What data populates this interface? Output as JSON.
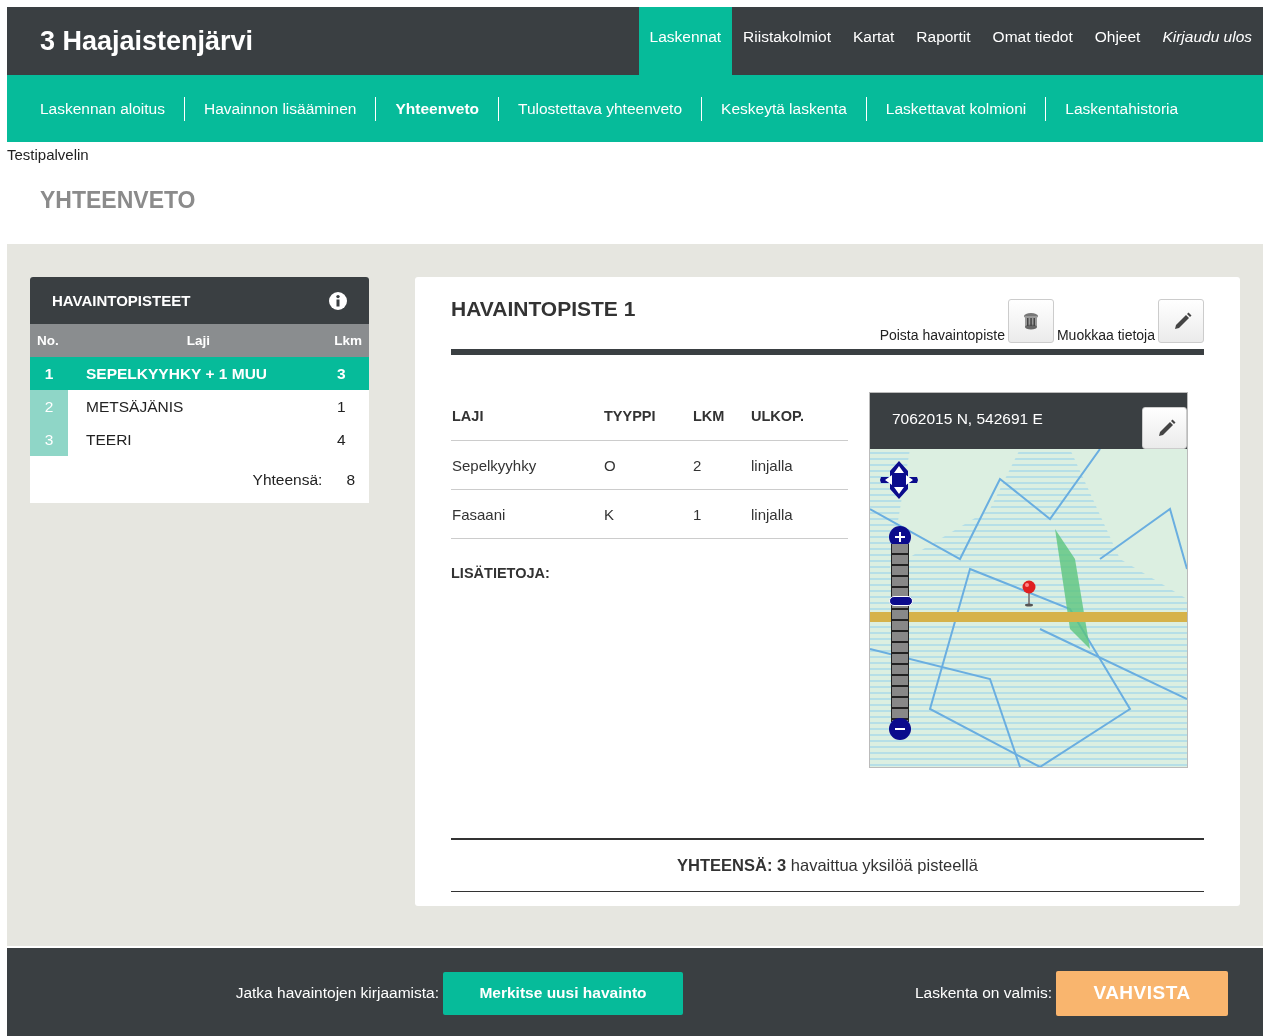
{
  "header": {
    "title": "3 Haajaistenjärvi",
    "menu": [
      {
        "label": "Laskennat",
        "selected": true,
        "kind": "link"
      },
      {
        "label": "Riistakolmiot",
        "selected": false,
        "kind": "link"
      },
      {
        "label": "Kartat",
        "selected": false,
        "kind": "link"
      },
      {
        "label": "Raportit",
        "selected": false,
        "kind": "link"
      },
      {
        "label": "Omat tiedot",
        "selected": false,
        "kind": "link"
      },
      {
        "label": "Ohjeet",
        "selected": false,
        "kind": "link"
      },
      {
        "label": "Kirjaudu ulos",
        "selected": false,
        "kind": "logout"
      }
    ]
  },
  "subnav": [
    {
      "label": "Laskennan aloitus",
      "selected": false
    },
    {
      "label": "Havainnon lisääminen",
      "selected": false
    },
    {
      "label": "Yhteenveto",
      "selected": true
    },
    {
      "label": "Tulostettava yhteenveto",
      "selected": false
    },
    {
      "label": "Keskeytä laskenta",
      "selected": false
    },
    {
      "label": "Laskettavat kolmioni",
      "selected": false
    },
    {
      "label": "Laskentahistoria",
      "selected": false
    }
  ],
  "environment": "Testipalvelin",
  "page_title": "YHTEENVETO",
  "points_panel": {
    "title": "HAVAINTOPISTEET",
    "columns": [
      "No.",
      "Laji",
      "Lkm"
    ],
    "rows": [
      {
        "no": "1",
        "species": "SEPELKYYHKY + 1 MUU",
        "count": "3",
        "selected": true
      },
      {
        "no": "2",
        "species": "METSÄJÄNIS",
        "count": "1",
        "selected": false
      },
      {
        "no": "3",
        "species": "TEERI",
        "count": "4",
        "selected": false
      }
    ],
    "total_label": "Yhteensä:",
    "total": "8"
  },
  "point": {
    "title": "HAVAINTOPISTE 1",
    "delete_label": "Poista havaintopiste",
    "edit_label": "Muokkaa tietoja",
    "columns": [
      "LAJI",
      "TYYPPI",
      "LKM",
      "ULKOP."
    ],
    "rows": [
      [
        "Sepelkyyhky",
        "O",
        "2",
        "linjalla"
      ],
      [
        "Fasaani",
        "K",
        "1",
        "linjalla"
      ]
    ],
    "notes_label": "LISÄTIETOJA:",
    "map": {
      "coordinates": "7062015 N, 542691 E",
      "zoom": {
        "level": 0.69
      }
    },
    "summary": "**YHTEENSÄ: 3** havaittua yksilöä pisteellä"
  },
  "footer": {
    "continue_label": "Jatka havaintojen kirjaamista:",
    "new_button": "Merkitse uusi havainto",
    "done_label": "Laskenta on valmis:",
    "confirm_button": "VAHVISTA"
  }
}
